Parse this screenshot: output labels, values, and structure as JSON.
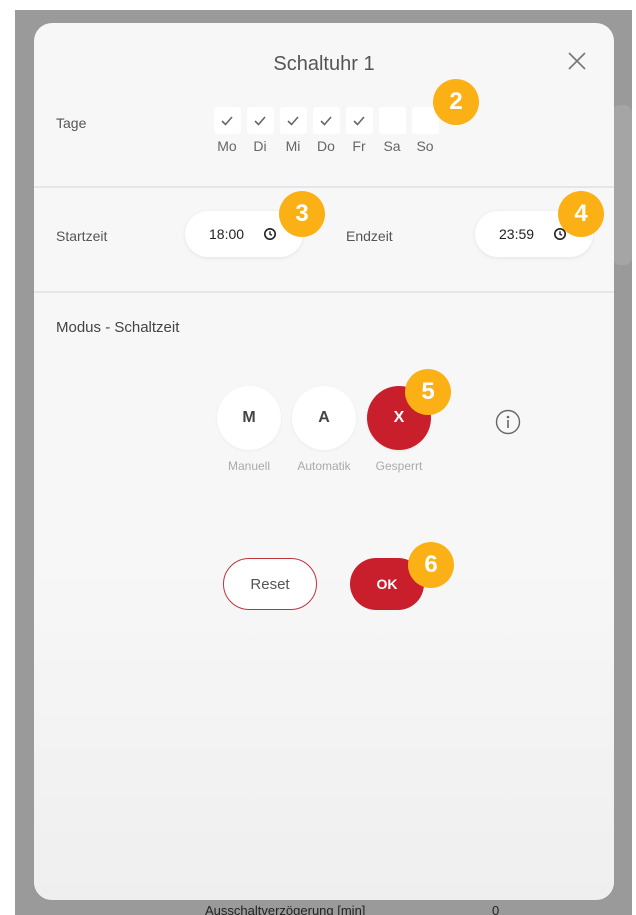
{
  "dialog": {
    "title": "Schaltuhr 1"
  },
  "days": {
    "label": "Tage",
    "items": [
      {
        "label": "Mo",
        "checked": true
      },
      {
        "label": "Di",
        "checked": true
      },
      {
        "label": "Mi",
        "checked": true
      },
      {
        "label": "Do",
        "checked": true
      },
      {
        "label": "Fr",
        "checked": true
      },
      {
        "label": "Sa",
        "checked": false
      },
      {
        "label": "So",
        "checked": false
      }
    ]
  },
  "times": {
    "start_label": "Startzeit",
    "start_value": "18:00",
    "end_label": "Endzeit",
    "end_value": "23:59"
  },
  "mode": {
    "section_title": "Modus - Schaltzeit",
    "options": [
      {
        "letter": "M",
        "label": "Manuell",
        "active": false
      },
      {
        "letter": "A",
        "label": "Automatik",
        "active": false
      },
      {
        "letter": "X",
        "label": "Gesperrt",
        "active": true
      }
    ]
  },
  "actions": {
    "reset_label": "Reset",
    "ok_label": "OK"
  },
  "badges": [
    "2",
    "3",
    "4",
    "5",
    "6"
  ],
  "background": {
    "row_label": "Ausschaltverzögerung [min]",
    "row_value": "0"
  },
  "colors": {
    "accent": "#c91f2c",
    "badge": "#fbb116",
    "backdrop": "#9a9a9a",
    "dialog": "#f7f7f7"
  }
}
